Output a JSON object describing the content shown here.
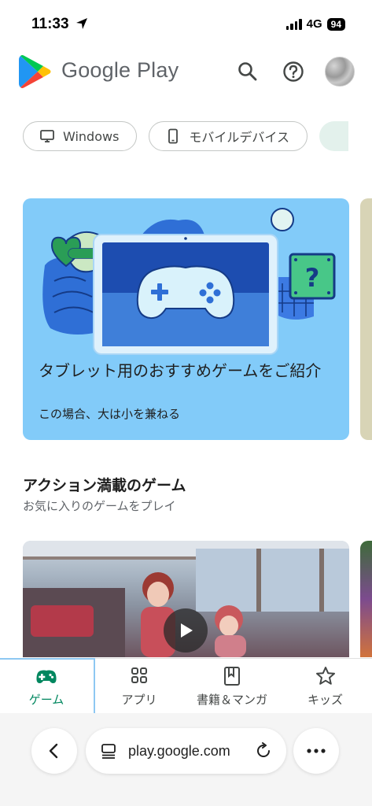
{
  "status_bar": {
    "time": "11:33",
    "network": "4G",
    "battery": "94"
  },
  "header": {
    "brand": "Google Play",
    "icons": [
      "search-icon",
      "help-icon",
      "avatar"
    ]
  },
  "chips": [
    {
      "label": "Windows",
      "icon": "monitor-icon"
    },
    {
      "label": "モバイルデバイス",
      "icon": "phone-icon"
    }
  ],
  "featured": {
    "title": "タブレット用のおすすめゲームをご紹介",
    "subtitle": "この場合、大は小を兼ねる"
  },
  "section": {
    "title": "アクション満載のゲーム",
    "subtitle": "お気に入りのゲームをプレイ"
  },
  "bottom_nav": [
    {
      "label": "ゲーム",
      "icon": "gamepad-icon",
      "active": true
    },
    {
      "label": "アプリ",
      "icon": "apps-grid-icon",
      "active": false
    },
    {
      "label": "書籍＆マンガ",
      "icon": "bookmark-icon",
      "active": false
    },
    {
      "label": "キッズ",
      "icon": "star-icon",
      "active": false
    }
  ],
  "browser": {
    "url": "play.google.com"
  },
  "colors": {
    "accent": "#01875f",
    "feature_bg": "#82cbf9",
    "text": "#1f1f1f"
  }
}
